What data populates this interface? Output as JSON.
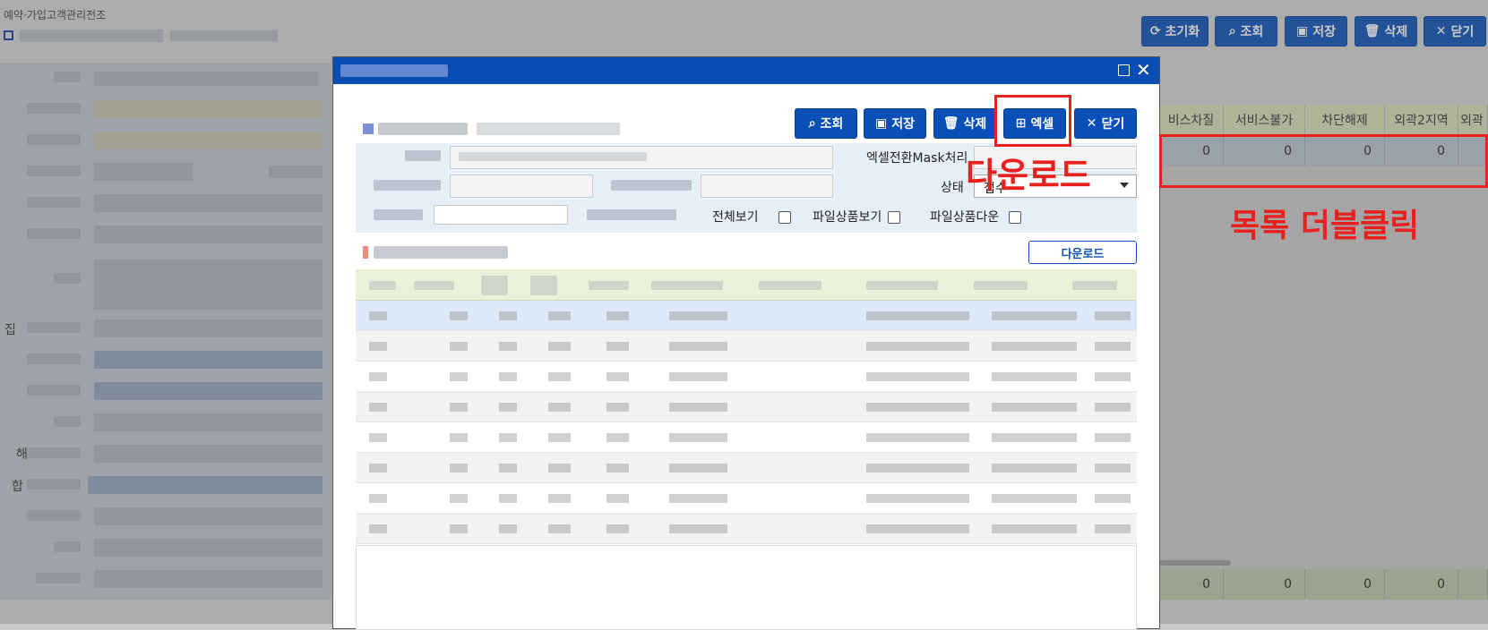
{
  "background": {
    "breadcrumb": "예약·가입고객관리전조",
    "toolbar": {
      "reset_label": "초기화",
      "search_label": "조회",
      "save_label": "저장",
      "delete_label": "삭제",
      "close_label": "닫기"
    },
    "side_label_1": "집",
    "side_label_2": "해",
    "side_label_3": "합",
    "grid": {
      "headers": [
        "비스차질",
        "서비스불가",
        "차단해제",
        "외곽2지역",
        "외곽"
      ],
      "row_values": [
        "0",
        "0",
        "0",
        "0"
      ],
      "sum_values": [
        "0",
        "0",
        "0",
        "0"
      ]
    }
  },
  "modal": {
    "buttons": {
      "search_label": "조회",
      "save_label": "저장",
      "delete_label": "삭제",
      "excel_label": "엑셀",
      "close_label": "닫기"
    },
    "form": {
      "mask_label": "엑셀전환Mask처리",
      "status_label": "상태",
      "status_value": "접수",
      "view_all_label": "전체보기",
      "file_view_label": "파일상품보기",
      "file_download_label": "파일상품다운"
    },
    "download_button_label": "다운로드"
  },
  "annotations": {
    "excel_note": "다운로드",
    "grid_note": "목록 더블클릭",
    "color": "#e8211e"
  },
  "colors": {
    "accent": "#0a4fb5",
    "title_bar": "#0b4db2",
    "grid_header": "#e8f2d8",
    "selected_row": "#dde9f8"
  }
}
